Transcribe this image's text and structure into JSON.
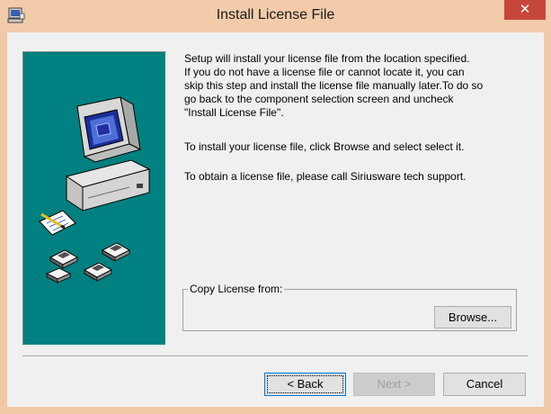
{
  "window": {
    "title": "Install License File",
    "close_glyph": "✕"
  },
  "message": {
    "paragraph1": "Setup will install your license file from the location specified.\nIf you do not have a license file or cannot locate it, you can\nskip this step and install the license file manually later.To do so\ngo back to the component selection screen and uncheck\n\"Install License File\".",
    "paragraph2": "To install your license file, click Browse and select select it.",
    "paragraph3": "To obtain a license file, please call Siriusware tech support."
  },
  "license_group": {
    "label": "Copy License from:",
    "browse_label": "Browse..."
  },
  "buttons": {
    "back_label": "< Back",
    "next_label": "Next >",
    "cancel_label": "Cancel"
  },
  "icons": {
    "title_icon": "setup-icon",
    "artwork": "computer-with-disks-illustration"
  },
  "colors": {
    "title_bar": "#f2cbaa",
    "close_button": "#c7463c",
    "art_panel": "#008080",
    "dialog_face": "#f0f0f0"
  }
}
